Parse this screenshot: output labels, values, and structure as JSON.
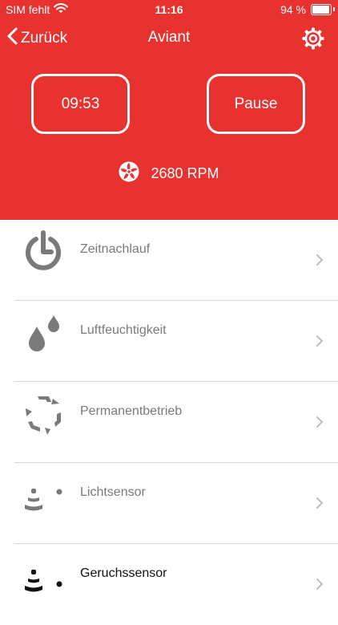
{
  "status_bar": {
    "carrier": "SIM fehlt",
    "time": "11:16",
    "battery": "94 %",
    "battery_level": 0.94
  },
  "nav": {
    "back_label": "Zurück",
    "title": "Aviant"
  },
  "controls": {
    "timer": "09:53",
    "pause": "Pause"
  },
  "fan": {
    "rpm": "2680 RPM"
  },
  "colors": {
    "header": "#e8322f",
    "icon_gray": "#7a7a7a",
    "icon_active": "#111111"
  },
  "menu": {
    "items": [
      {
        "label": "Zeitnachlauf",
        "icon": "power-timer-icon"
      },
      {
        "label": "Luftfeuchtigkeit",
        "icon": "droplets-icon"
      },
      {
        "label": "Permanentbetrieb",
        "icon": "cycle-arrows-icon"
      },
      {
        "label": "Lichtsensor",
        "icon": "light-sensor-icon"
      },
      {
        "label": "Geruchssensor",
        "icon": "odor-sensor-icon"
      }
    ]
  }
}
